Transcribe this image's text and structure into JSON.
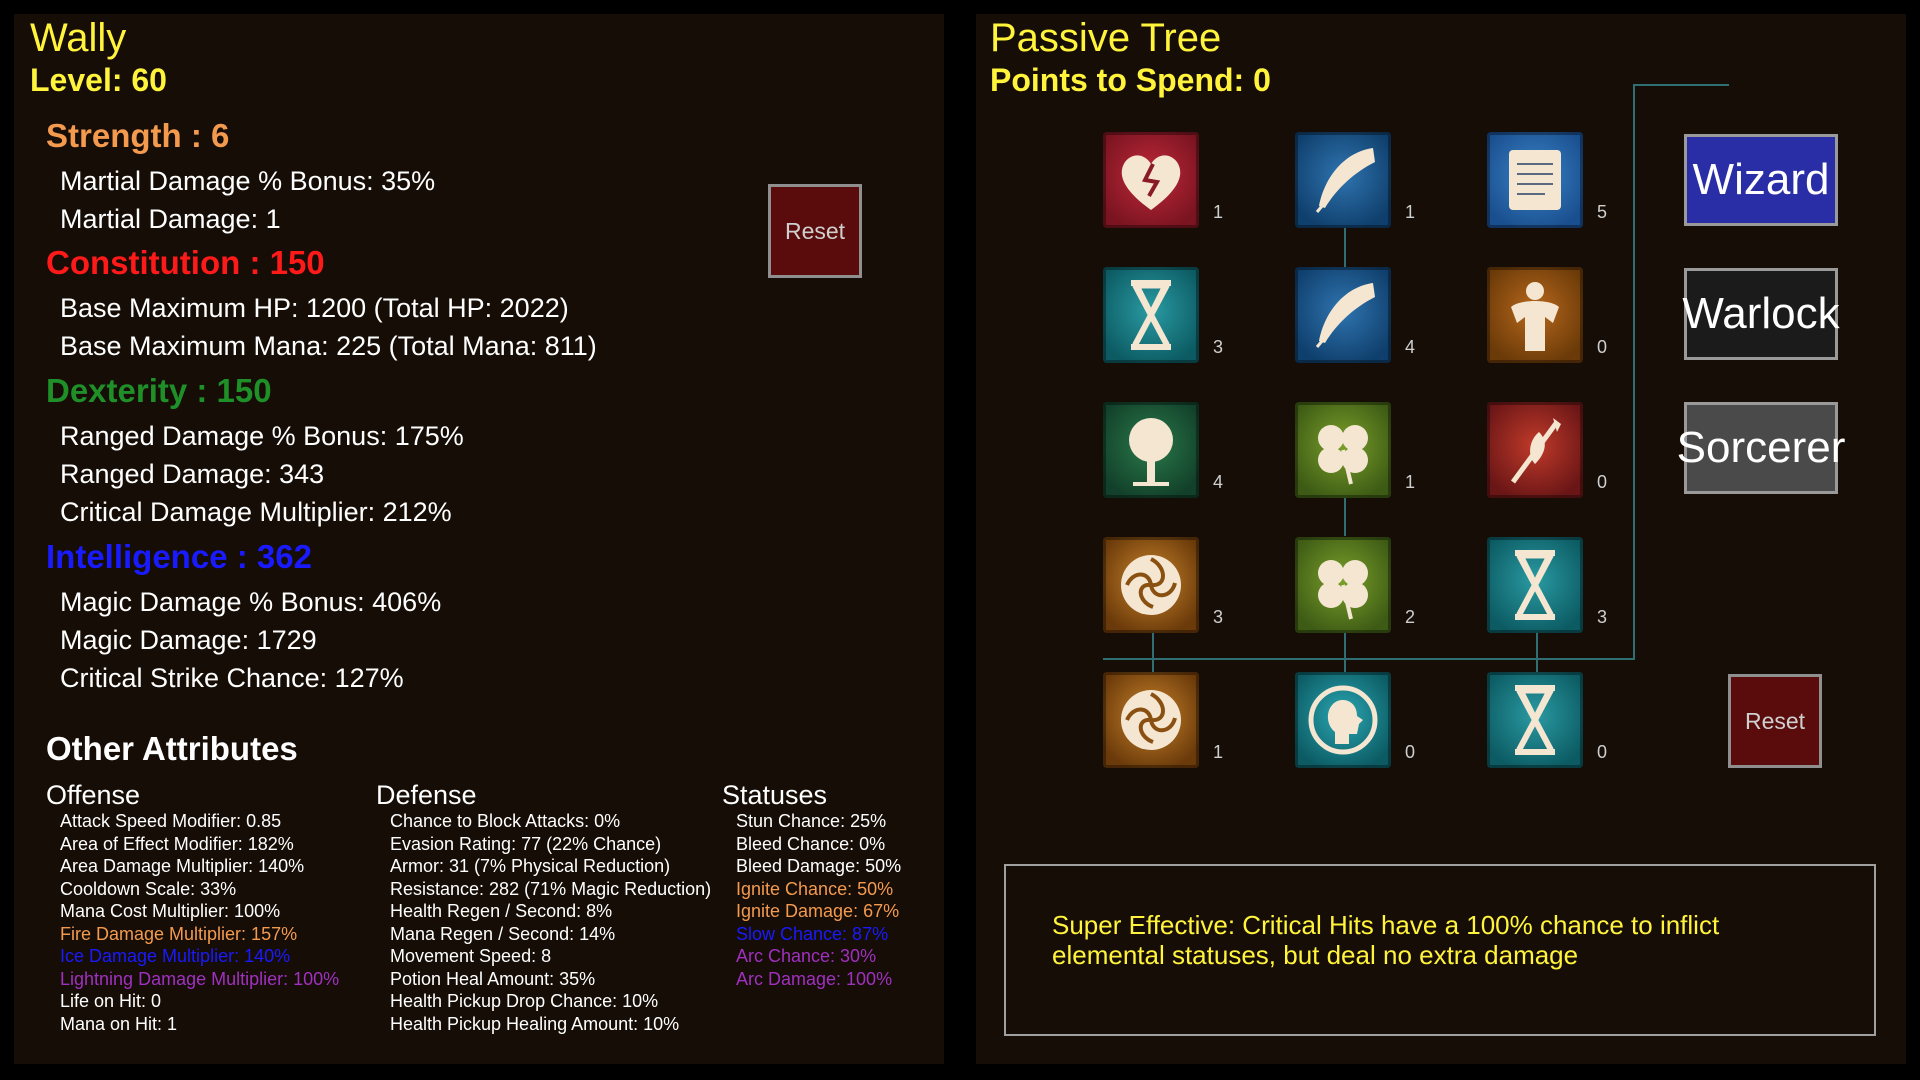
{
  "character": {
    "name": "Wally",
    "level_label": "Level: 60"
  },
  "stats": [
    {
      "header": "Strength : 6",
      "color": "#f39a4f",
      "lines": [
        "Martial Damage % Bonus: 35%",
        "Martial Damage: 1"
      ]
    },
    {
      "header": "Constitution : 150",
      "color": "#ff1a1a",
      "lines": [
        "Base Maximum HP: 1200 (Total HP: 2022)",
        "Base Maximum Mana: 225 (Total Mana: 811)"
      ]
    },
    {
      "header": "Dexterity : 150",
      "color": "#1f8f28",
      "lines": [
        "Ranged Damage % Bonus: 175%",
        "Ranged Damage: 343",
        "Critical Damage Multiplier: 212%"
      ]
    },
    {
      "header": "Intelligence : 362",
      "color": "#1a1aff",
      "lines": [
        "Magic Damage % Bonus: 406%",
        "Magic Damage: 1729",
        "Critical Strike Chance: 127%"
      ]
    }
  ],
  "left_reset_label": "Reset",
  "other_attributes": {
    "title": "Other Attributes",
    "offense": {
      "header": "Offense",
      "lines": [
        {
          "text": "Attack Speed Modifier: 0.85",
          "color": "#ffffff"
        },
        {
          "text": "Area of Effect Modifier: 182%",
          "color": "#ffffff"
        },
        {
          "text": "Area Damage Multiplier: 140%",
          "color": "#ffffff"
        },
        {
          "text": "Cooldown Scale: 33%",
          "color": "#ffffff"
        },
        {
          "text": "Mana Cost Multiplier: 100%",
          "color": "#ffffff"
        },
        {
          "text": "Fire Damage Multiplier: 157%",
          "color": "#f39a4f"
        },
        {
          "text": "Ice Damage Multiplier: 140%",
          "color": "#1a1aff"
        },
        {
          "text": "Lightning Damage Multiplier: 100%",
          "color": "#a030c0"
        },
        {
          "text": "Life on Hit: 0",
          "color": "#ffffff"
        },
        {
          "text": "Mana on Hit: 1",
          "color": "#ffffff"
        }
      ]
    },
    "defense": {
      "header": "Defense",
      "lines": [
        {
          "text": "Chance to Block Attacks: 0%",
          "color": "#ffffff"
        },
        {
          "text": "Evasion Rating: 77 (22% Chance)",
          "color": "#ffffff"
        },
        {
          "text": "Armor: 31 (7% Physical Reduction)",
          "color": "#ffffff"
        },
        {
          "text": "Resistance: 282 (71% Magic Reduction)",
          "color": "#ffffff"
        },
        {
          "text": "Health Regen / Second: 8%",
          "color": "#ffffff"
        },
        {
          "text": "Mana Regen / Second: 14%",
          "color": "#ffffff"
        },
        {
          "text": "Movement Speed: 8",
          "color": "#ffffff"
        },
        {
          "text": "Potion Heal Amount: 35%",
          "color": "#ffffff"
        },
        {
          "text": "Health Pickup Drop Chance: 10%",
          "color": "#ffffff"
        },
        {
          "text": "Health Pickup Healing Amount: 10%",
          "color": "#ffffff"
        }
      ]
    },
    "statuses": {
      "header": "Statuses",
      "lines": [
        {
          "text": "Stun Chance: 25%",
          "color": "#ffffff"
        },
        {
          "text": "Bleed Chance: 0%",
          "color": "#ffffff"
        },
        {
          "text": "Bleed Damage: 50%",
          "color": "#ffffff"
        },
        {
          "text": "Ignite Chance: 50%",
          "color": "#f39a4f"
        },
        {
          "text": "Ignite Damage: 67%",
          "color": "#f39a4f"
        },
        {
          "text": "Slow Chance: 87%",
          "color": "#1a1aff"
        },
        {
          "text": "Arc Chance: 30%",
          "color": "#a030c0"
        },
        {
          "text": "Arc Damage: 100%",
          "color": "#a030c0"
        }
      ]
    }
  },
  "passive_tree": {
    "title": "Passive Tree",
    "points_label": "Points to Spend: 0",
    "nodes": [
      {
        "icon": "broken-heart-icon",
        "count": "1"
      },
      {
        "icon": "feather-icon",
        "count": "1"
      },
      {
        "icon": "scroll-icon",
        "count": "5"
      },
      {
        "icon": "hourglass-icon",
        "count": "3"
      },
      {
        "icon": "feather-icon",
        "count": "4"
      },
      {
        "icon": "strongman-icon",
        "count": "0"
      },
      {
        "icon": "tree-icon",
        "count": "4"
      },
      {
        "icon": "clover-icon",
        "count": "1"
      },
      {
        "icon": "halberd-icon",
        "count": "0"
      },
      {
        "icon": "swirl-icon",
        "count": "3"
      },
      {
        "icon": "clover-icon",
        "count": "2"
      },
      {
        "icon": "hourglass-icon",
        "count": "3"
      },
      {
        "icon": "swirl-icon",
        "count": "1"
      },
      {
        "icon": "head-icon",
        "count": "0"
      },
      {
        "icon": "hourglass-icon",
        "count": "0"
      }
    ],
    "classes": [
      {
        "label": "Wizard",
        "color": "#2a2ea6"
      },
      {
        "label": "Warlock",
        "color": "#1b1b1b"
      },
      {
        "label": "Sorcerer",
        "color": "#4a4a4a"
      }
    ],
    "reset_label": "Reset",
    "description": "Super Effective: Critical Hits have a 100% chance to inflict elemental statuses, but deal no extra damage"
  }
}
